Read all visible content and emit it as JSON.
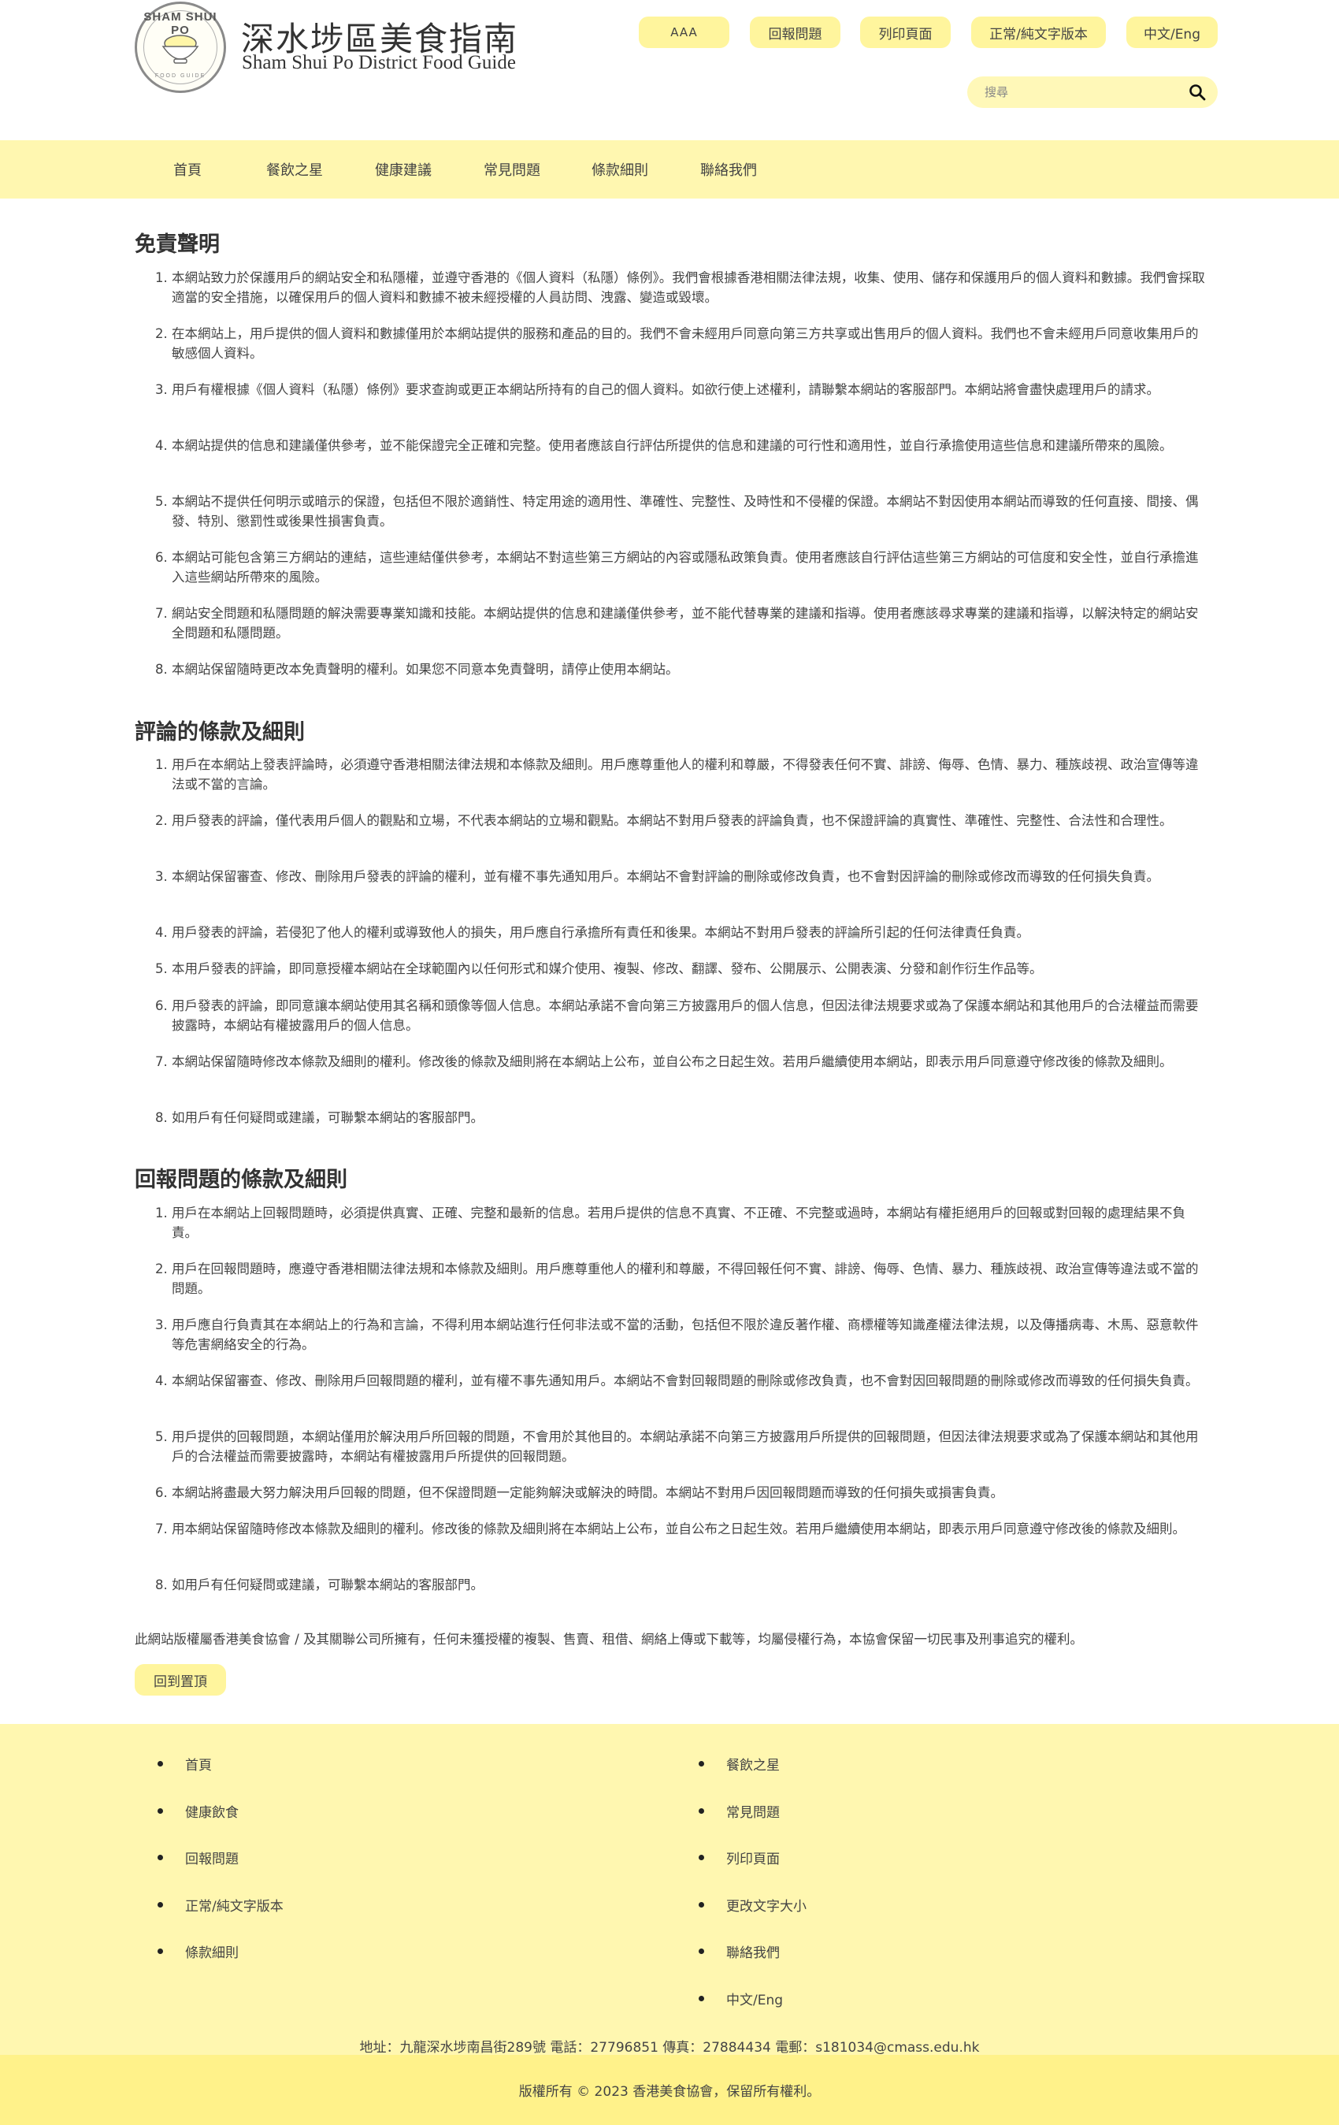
{
  "header": {
    "logo_text_top": "SHAM SHUI PO",
    "logo_text_bottom": "FOOD GUIDE",
    "title_zh": "深水埗區美食指南",
    "title_en": "Sham Shui Po District Food Guide",
    "buttons": {
      "font_size": "AAA",
      "report": "回報問題",
      "print": "列印頁面",
      "text_version": "正常/純文字版本",
      "language": "中文/Eng"
    },
    "search_placeholder": "搜尋"
  },
  "nav": [
    "首頁",
    "餐飲之星",
    "健康建議",
    "常見問題",
    "條款細則",
    "聯絡我們"
  ],
  "sections": [
    {
      "title": "免責聲明",
      "items": [
        "本網站致力於保護用戶的網站安全和私隱權，並遵守香港的《個人資料（私隱）條例》。我們會根據香港相關法律法規，收集、使用、儲存和保護用戶的個人資料和數據。我們會採取適當的安全措施，以確保用戶的個人資料和數據不被未經授權的人員訪問、洩露、變造或毀壞。",
        "在本網站上，用戶提供的個人資料和數據僅用於本網站提供的服務和產品的目的。我們不會未經用戶同意向第三方共享或出售用戶的個人資料。我們也不會未經用戶同意收集用戶的敏感個人資料。",
        "用戶有權根據《個人資料（私隱）條例》要求查詢或更正本網站所持有的自己的個人資料。如欲行使上述權利，請聯繫本網站的客服部門。本網站將會盡快處理用戶的請求。",
        "本網站提供的信息和建議僅供參考，並不能保證完全正確和完整。使用者應該自行評估所提供的信息和建議的可行性和適用性，並自行承擔使用這些信息和建議所帶來的風險。",
        "本網站不提供任何明示或暗示的保證，包括但不限於適銷性、特定用途的適用性、準確性、完整性、及時性和不侵權的保證。本網站不對因使用本網站而導致的任何直接、間接、偶發、特別、懲罰性或後果性損害負責。",
        "本網站可能包含第三方網站的連結，這些連結僅供參考，本網站不對這些第三方網站的內容或隱私政策負責。使用者應該自行評估這些第三方網站的可信度和安全性，並自行承擔進入這些網站所帶來的風險。",
        "網站安全問題和私隱問題的解決需要專業知識和技能。本網站提供的信息和建議僅供參考，並不能代替專業的建議和指導。使用者應該尋求專業的建議和指導，以解決特定的網站安全問題和私隱問題。",
        "本網站保留隨時更改本免責聲明的權利。如果您不同意本免責聲明，請停止使用本網站。"
      ]
    },
    {
      "title": "評論的條款及細則",
      "items": [
        "用戶在本網站上發表評論時，必須遵守香港相關法律法規和本條款及細則。用戶應尊重他人的權利和尊嚴，不得發表任何不實、誹謗、侮辱、色情、暴力、種族歧視、政治宣傳等違法或不當的言論。",
        "用戶發表的評論，僅代表用戶個人的觀點和立場，不代表本網站的立場和觀點。本網站不對用戶發表的評論負責，也不保證評論的真實性、準確性、完整性、合法性和合理性。",
        "本網站保留審查、修改、刪除用戶發表的評論的權利，並有權不事先通知用戶。本網站不會對評論的刪除或修改負責，也不會對因評論的刪除或修改而導致的任何損失負責。",
        "用戶發表的評論，若侵犯了他人的權利或導致他人的損失，用戶應自行承擔所有責任和後果。本網站不對用戶發表的評論所引起的任何法律責任負責。",
        "本用戶發表的評論，即同意授權本網站在全球範圍內以任何形式和媒介使用、複製、修改、翻譯、發布、公開展示、公開表演、分發和創作衍生作品等。",
        "用戶發表的評論，即同意讓本網站使用其名稱和頭像等個人信息。本網站承諾不會向第三方披露用戶的個人信息，但因法律法規要求或為了保護本網站和其他用戶的合法權益而需要披露時，本網站有權披露用戶的個人信息。",
        "本網站保留隨時修改本條款及細則的權利。修改後的條款及細則將在本網站上公布，並自公布之日起生效。若用戶繼續使用本網站，即表示用戶同意遵守修改後的條款及細則。",
        "如用戶有任何疑問或建議，可聯繫本網站的客服部門。"
      ]
    },
    {
      "title": "回報問題的條款及細則",
      "items": [
        "用戶在本網站上回報問題時，必須提供真實、正確、完整和最新的信息。若用戶提供的信息不真實、不正確、不完整或過時，本網站有權拒絕用戶的回報或對回報的處理結果不負責。",
        "用戶在回報問題時，應遵守香港相關法律法規和本條款及細則。用戶應尊重他人的權利和尊嚴，不得回報任何不實、誹謗、侮辱、色情、暴力、種族歧視、政治宣傳等違法或不當的問題。",
        "用戶應自行負責其在本網站上的行為和言論，不得利用本網站進行任何非法或不當的活動，包括但不限於違反著作權、商標權等知識產權法律法規，以及傳播病毒、木馬、惡意軟件等危害網絡安全的行為。",
        "本網站保留審查、修改、刪除用戶回報問題的權利，並有權不事先通知用戶。本網站不會對回報問題的刪除或修改負責，也不會對因回報問題的刪除或修改而導致的任何損失負責。",
        "用戶提供的回報問題，本網站僅用於解決用戶所回報的問題，不會用於其他目的。本網站承諾不向第三方披露用戶所提供的回報問題，但因法律法規要求或為了保護本網站和其他用戶的合法權益而需要披露時，本網站有權披露用戶所提供的回報問題。",
        "本網站將盡最大努力解決用戶回報的問題，但不保證問題一定能夠解決或解決的時間。本網站不對用戶因回報問題而導致的任何損失或損害負責。",
        "用本網站保留隨時修改本條款及細則的權利。修改後的條款及細則將在本網站上公布，並自公布之日起生效。若用戶繼續使用本網站，即表示用戶同意遵守修改後的條款及細則。",
        "如用戶有任何疑問或建議，可聯繫本網站的客服部門。"
      ]
    }
  ],
  "copyright_note": "此網站版權屬香港美食協會 / 及其關聯公司所擁有，任何未獲授權的複製、售賣、租借、網絡上傳或下載等，均屬侵權行為，本協會保留一切民事及刑事追究的權利。",
  "back_to_top": "回到置頂",
  "footer": {
    "left": [
      "首頁",
      "健康飲食",
      "回報問題",
      "正常/純文字版本",
      "條款細則"
    ],
    "right": [
      "餐飲之星",
      "常見問題",
      "列印頁面",
      "更改文字大小",
      "聯絡我們",
      "中文/Eng"
    ],
    "address": "地址：九龍深水埗南昌街289號 電話：27796851 傳真：27884434 電郵：s181034@cmass.edu.hk",
    "copyright": "版權所有 © 2023 香港美食協會，保留所有權利。"
  },
  "colors": {
    "accent_yellow": "#fff59d",
    "nav_background": "#fff7b0",
    "bottom_bar": "#fff28a"
  }
}
